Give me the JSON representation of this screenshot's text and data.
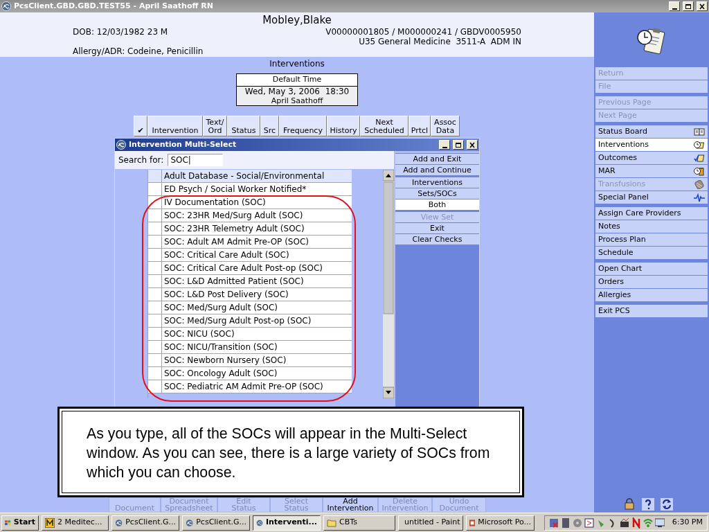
{
  "window": {
    "title": "PcsClient.GBD.GBD.TEST55 - April Saathoff RN"
  },
  "patient": {
    "name": "Mobley,Blake",
    "dob": "DOB: 12/03/1982 23 M",
    "ids": "V00000001805 / M000000241 / GBDV0005950",
    "location": "U35 General Medicine  3511-A  ADM IN",
    "allergy": "Allergy/ADR: Codeine, Penicillin"
  },
  "page_title": "Interventions",
  "default_time": {
    "label": "Default Time",
    "datetime": "Wed, May 3, 2006  18:30",
    "user": "April Saathoff"
  },
  "grid_columns": [
    {
      "lines": [
        "✔"
      ]
    },
    {
      "lines": [
        "Intervention"
      ]
    },
    {
      "lines": [
        "Text/",
        "Ord"
      ]
    },
    {
      "lines": [
        "Status"
      ]
    },
    {
      "lines": [
        "Src"
      ]
    },
    {
      "lines": [
        "Frequency"
      ]
    },
    {
      "lines": [
        "History"
      ]
    },
    {
      "lines": [
        "Next",
        "Scheduled"
      ]
    },
    {
      "lines": [
        "Prtcl"
      ]
    },
    {
      "lines": [
        "Assoc",
        "Data"
      ]
    }
  ],
  "dialog": {
    "title": "Intervention Multi-Select",
    "search_label": "Search for:",
    "search_value": "SOC|",
    "items": [
      {
        "label": "Adult Database - Social/Environmental",
        "selected": true
      },
      {
        "label": "ED Psych / Social Worker Notified*",
        "selected": false
      },
      {
        "label": "IV Documentation (SOC)",
        "selected": false
      },
      {
        "label": "SOC: 23HR Med/Surg Adult (SOC)",
        "selected": false
      },
      {
        "label": "SOC: 23HR Telemetry Adult (SOC)",
        "selected": false
      },
      {
        "label": "SOC: Adult AM Admit Pre-OP (SOC)",
        "selected": false
      },
      {
        "label": "SOC: Critical Care Adult (SOC)",
        "selected": false
      },
      {
        "label": "SOC: Critical Care Adult Post-op (SOC)",
        "selected": false
      },
      {
        "label": "SOC: L&D Admitted Patient (SOC)",
        "selected": false
      },
      {
        "label": "SOC: L&D Post Delivery (SOC)",
        "selected": false
      },
      {
        "label": "SOC: Med/Surg Adult (SOC)",
        "selected": false
      },
      {
        "label": "SOC: Med/Surg Adult Post-op (SOC)",
        "selected": false
      },
      {
        "label": "SOC: NICU (SOC)",
        "selected": false
      },
      {
        "label": "SOC: NICU/Transition (SOC)",
        "selected": false
      },
      {
        "label": "SOC: Newborn Nursery (SOC)",
        "selected": false
      },
      {
        "label": "SOC: Oncology Adult (SOC)",
        "selected": false
      },
      {
        "label": "SOC: Pediatric AM Admit Pre-OP (SOC)",
        "selected": false
      }
    ],
    "buttons": [
      {
        "label": "Add and Exit",
        "kind": "action",
        "disabled": false
      },
      {
        "label": "Add and Continue",
        "kind": "action",
        "disabled": false
      },
      {
        "label": "Interventions",
        "kind": "filter",
        "selected": false
      },
      {
        "label": "Sets/SOCs",
        "kind": "filter",
        "selected": false
      },
      {
        "label": "Both",
        "kind": "filter",
        "selected": true
      },
      {
        "label": "View Set",
        "kind": "action",
        "disabled": true
      },
      {
        "label": "Exit",
        "kind": "action",
        "disabled": false
      },
      {
        "label": "Clear Checks",
        "kind": "action",
        "disabled": false
      }
    ]
  },
  "callout": "As you type, all of the SOCs will appear in the Multi-Select window. As you can see, there is a large variety of SOCs from which you can choose.",
  "toolbar": [
    {
      "lines": [
        "Document"
      ],
      "disabled": true
    },
    {
      "lines": [
        "Document",
        "Spreadsheet"
      ],
      "disabled": true
    },
    {
      "lines": [
        "Edit",
        "Status"
      ],
      "disabled": true
    },
    {
      "lines": [
        "Select",
        "Status"
      ],
      "disabled": true
    },
    {
      "lines": [
        "Add",
        "Intervention"
      ],
      "disabled": false
    },
    {
      "lines": [
        "Delete",
        "Intervention"
      ],
      "disabled": true
    },
    {
      "lines": [
        "Undo",
        "Document"
      ],
      "disabled": true
    }
  ],
  "sidebar": {
    "groups": [
      [
        {
          "label": "Return",
          "disabled": true,
          "selected": false
        },
        {
          "label": "File",
          "disabled": true,
          "selected": false
        }
      ],
      [
        {
          "label": "Previous Page",
          "disabled": true,
          "selected": false
        },
        {
          "label": "Next Page",
          "disabled": true,
          "selected": false
        }
      ],
      [
        {
          "label": "Status Board",
          "disabled": false,
          "selected": false
        },
        {
          "label": "Interventions",
          "disabled": false,
          "selected": true
        },
        {
          "label": "Outcomes",
          "disabled": false,
          "selected": false
        },
        {
          "label": "MAR",
          "disabled": false,
          "selected": false
        },
        {
          "label": "Transfusions",
          "disabled": true,
          "selected": false
        },
        {
          "label": "Special Panel",
          "disabled": false,
          "selected": false
        }
      ],
      [
        {
          "label": "Assign Care Providers",
          "disabled": false,
          "selected": false
        },
        {
          "label": "Notes",
          "disabled": false,
          "selected": false
        },
        {
          "label": "Process Plan",
          "disabled": false,
          "selected": false
        },
        {
          "label": "Schedule",
          "disabled": false,
          "selected": false
        }
      ],
      [
        {
          "label": "Open Chart",
          "disabled": false,
          "selected": false
        },
        {
          "label": "Orders",
          "disabled": false,
          "selected": false
        },
        {
          "label": "Allergies",
          "disabled": false,
          "selected": false
        }
      ],
      [
        {
          "label": "Exit PCS",
          "disabled": false,
          "selected": false
        }
      ]
    ]
  },
  "taskbar": {
    "start": "Start",
    "tasks": [
      {
        "label": "2 Meditec...",
        "selected": false
      },
      {
        "label": "PcsClient.G...",
        "selected": false
      },
      {
        "label": "PcsClient.G...",
        "selected": false
      },
      {
        "label": "Interventi...",
        "selected": true
      },
      {
        "label": "CBTs",
        "selected": false
      },
      {
        "label": "untitled - Paint",
        "selected": false
      },
      {
        "label": "Microsoft Po...",
        "selected": false
      }
    ],
    "clock": "6:30 PM"
  }
}
